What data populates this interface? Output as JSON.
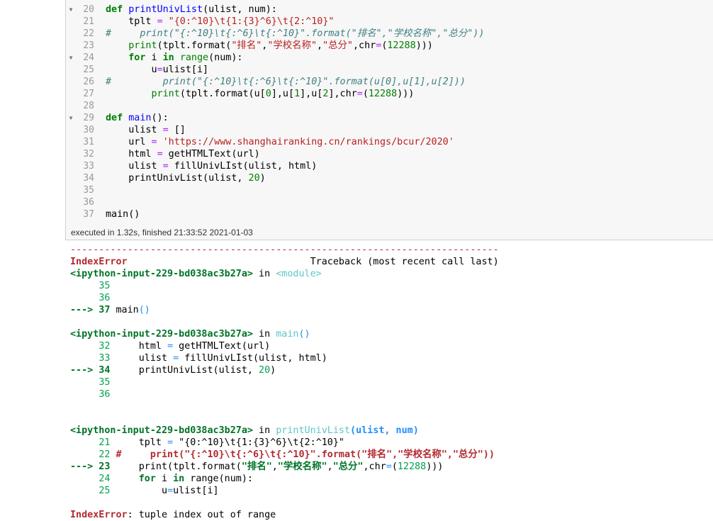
{
  "editor": {
    "lines": [
      {
        "no": "20",
        "fold": true,
        "parts": [
          {
            "t": "def ",
            "c": "kw"
          },
          {
            "t": "printUnivList",
            "c": "fn"
          },
          {
            "t": "(ulist, num):"
          }
        ]
      },
      {
        "no": "21",
        "parts": [
          {
            "t": "    tplt "
          },
          {
            "t": "=",
            "c": "op"
          },
          {
            "t": " \"{0:^10}\\t{1:{3}^6}\\t{2:^10}\"",
            "c": "st"
          }
        ]
      },
      {
        "no": "22",
        "parts": [
          {
            "t": "#     print(\"{:^10}\\t{:^6}\\t{:^10}\".format(\"排名\",\"学校名称\",\"总分\"))",
            "c": "cm"
          }
        ]
      },
      {
        "no": "23",
        "parts": [
          {
            "t": "    "
          },
          {
            "t": "print",
            "c": "bi"
          },
          {
            "t": "(tplt.format("
          },
          {
            "t": "\"排名\"",
            "c": "st"
          },
          {
            "t": ","
          },
          {
            "t": "\"学校名称\"",
            "c": "st"
          },
          {
            "t": ","
          },
          {
            "t": "\"总分\"",
            "c": "st"
          },
          {
            "t": ",chr"
          },
          {
            "t": "=",
            "c": "op"
          },
          {
            "t": "("
          },
          {
            "t": "12288",
            "c": "num"
          },
          {
            "t": ")))"
          }
        ]
      },
      {
        "no": "24",
        "fold": true,
        "parts": [
          {
            "t": "    "
          },
          {
            "t": "for",
            "c": "kw"
          },
          {
            "t": " i "
          },
          {
            "t": "in",
            "c": "kw"
          },
          {
            "t": " "
          },
          {
            "t": "range",
            "c": "bi"
          },
          {
            "t": "(num):"
          }
        ]
      },
      {
        "no": "25",
        "parts": [
          {
            "t": "        u"
          },
          {
            "t": "=",
            "c": "op"
          },
          {
            "t": "ulist[i]"
          }
        ]
      },
      {
        "no": "26",
        "parts": [
          {
            "t": "#         print(\"{:^10}\\t{:^6}\\t{:^10}\".format(u[0],u[1],u[2]))",
            "c": "cm"
          }
        ]
      },
      {
        "no": "27",
        "parts": [
          {
            "t": "        "
          },
          {
            "t": "print",
            "c": "bi"
          },
          {
            "t": "(tplt.format(u["
          },
          {
            "t": "0",
            "c": "num"
          },
          {
            "t": "],u["
          },
          {
            "t": "1",
            "c": "num"
          },
          {
            "t": "],u["
          },
          {
            "t": "2",
            "c": "num"
          },
          {
            "t": "],chr"
          },
          {
            "t": "=",
            "c": "op"
          },
          {
            "t": "("
          },
          {
            "t": "12288",
            "c": "num"
          },
          {
            "t": ")))"
          }
        ]
      },
      {
        "no": "28",
        "parts": []
      },
      {
        "no": "29",
        "fold": true,
        "parts": [
          {
            "t": "def ",
            "c": "kw"
          },
          {
            "t": "main",
            "c": "fn"
          },
          {
            "t": "():"
          }
        ]
      },
      {
        "no": "30",
        "parts": [
          {
            "t": "    ulist "
          },
          {
            "t": "=",
            "c": "op"
          },
          {
            "t": " []"
          }
        ]
      },
      {
        "no": "31",
        "parts": [
          {
            "t": "    url "
          },
          {
            "t": "=",
            "c": "op"
          },
          {
            "t": " "
          },
          {
            "t": "'https://www.shanghairanking.cn/rankings/bcur/2020'",
            "c": "st"
          }
        ]
      },
      {
        "no": "32",
        "parts": [
          {
            "t": "    html "
          },
          {
            "t": "=",
            "c": "op"
          },
          {
            "t": " getHTMLText(url)"
          }
        ]
      },
      {
        "no": "33",
        "parts": [
          {
            "t": "    ulist "
          },
          {
            "t": "=",
            "c": "op"
          },
          {
            "t": " fillUnivLIst(ulist, html)"
          }
        ]
      },
      {
        "no": "34",
        "parts": [
          {
            "t": "    printUnivList(ulist, "
          },
          {
            "t": "20",
            "c": "num"
          },
          {
            "t": ")"
          }
        ]
      },
      {
        "no": "35",
        "parts": []
      },
      {
        "no": "36",
        "parts": []
      },
      {
        "no": "37",
        "parts": [
          {
            "t": "main()"
          }
        ]
      }
    ]
  },
  "exec_status": "executed in 1.32s, finished 21:33:52 2021-01-03",
  "output": {
    "lines": [
      {
        "parts": [
          {
            "t": "---------------------------------------------------------------------------",
            "c": "dash"
          }
        ]
      },
      {
        "parts": [
          {
            "t": "IndexError",
            "c": "red bold"
          },
          {
            "t": "                                Traceback (most recent call last)"
          }
        ]
      },
      {
        "parts": [
          {
            "t": "<ipython-input-229-bd038ac3b27a>",
            "c": "green bold"
          },
          {
            "t": " in "
          },
          {
            "t": "<module>",
            "c": "cyan"
          }
        ]
      },
      {
        "parts": [
          {
            "t": "     "
          },
          {
            "t": "35",
            "c": "grn"
          }
        ]
      },
      {
        "parts": [
          {
            "t": "     "
          },
          {
            "t": "36",
            "c": "grn"
          }
        ]
      },
      {
        "parts": [
          {
            "t": "---> 37",
            "c": "green bold"
          },
          {
            "t": " main"
          },
          {
            "t": "()",
            "c": "blue"
          }
        ]
      },
      {
        "parts": []
      },
      {
        "parts": [
          {
            "t": "<ipython-input-229-bd038ac3b27a>",
            "c": "green bold"
          },
          {
            "t": " in "
          },
          {
            "t": "main",
            "c": "cyan"
          },
          {
            "t": "()",
            "c": "blue"
          }
        ]
      },
      {
        "parts": [
          {
            "t": "     "
          },
          {
            "t": "32",
            "c": "grn"
          },
          {
            "t": "     html "
          },
          {
            "t": "=",
            "c": "blue"
          },
          {
            "t": " getHTMLText(url)"
          }
        ]
      },
      {
        "parts": [
          {
            "t": "     "
          },
          {
            "t": "33",
            "c": "grn"
          },
          {
            "t": "     ulist "
          },
          {
            "t": "=",
            "c": "blue"
          },
          {
            "t": " fillUnivLIst(ulist, html)"
          }
        ]
      },
      {
        "parts": [
          {
            "t": "---> 34",
            "c": "green bold"
          },
          {
            "t": "     printUnivList(ulist, "
          },
          {
            "t": "20",
            "c": "grn"
          },
          {
            "t": ")"
          }
        ]
      },
      {
        "parts": [
          {
            "t": "     "
          },
          {
            "t": "35",
            "c": "grn"
          }
        ]
      },
      {
        "parts": [
          {
            "t": "     "
          },
          {
            "t": "36",
            "c": "grn"
          }
        ]
      },
      {
        "parts": []
      },
      {
        "parts": []
      },
      {
        "parts": [
          {
            "t": "<ipython-input-229-bd038ac3b27a>",
            "c": "green bold"
          },
          {
            "t": " in "
          },
          {
            "t": "printUnivList",
            "c": "cyan"
          },
          {
            "t": "(ulist, num)",
            "c": "blue bold"
          }
        ]
      },
      {
        "parts": [
          {
            "t": "     "
          },
          {
            "t": "21",
            "c": "grn"
          },
          {
            "t": "     tplt "
          },
          {
            "t": "=",
            "c": "blue"
          },
          {
            "t": " \"{0:^10}\\t{1:{3}^6}\\t{2:^10}\""
          }
        ]
      },
      {
        "parts": [
          {
            "t": "     "
          },
          {
            "t": "22",
            "c": "grn"
          },
          {
            "t": " #     print(\"{:^10}\\t{:^6}\\t{:^10}\".format(\"排名\",\"学校名称\",\"总分\"))",
            "c": "red bold"
          }
        ]
      },
      {
        "parts": [
          {
            "t": "---> 23",
            "c": "green bold"
          },
          {
            "t": "     print(tplt.format("
          },
          {
            "t": "\"排名\"",
            "c": "green bold"
          },
          {
            "t": ","
          },
          {
            "t": "\"学校名称\"",
            "c": "green bold"
          },
          {
            "t": ","
          },
          {
            "t": "\"总分\"",
            "c": "green bold"
          },
          {
            "t": ",chr"
          },
          {
            "t": "=",
            "c": "blue"
          },
          {
            "t": "("
          },
          {
            "t": "12288",
            "c": "grn"
          },
          {
            "t": ")))"
          }
        ]
      },
      {
        "parts": [
          {
            "t": "     "
          },
          {
            "t": "24",
            "c": "grn"
          },
          {
            "t": "     "
          },
          {
            "t": "for",
            "c": "green bold"
          },
          {
            "t": " i "
          },
          {
            "t": "in",
            "c": "green bold"
          },
          {
            "t": " range(num):"
          }
        ]
      },
      {
        "parts": [
          {
            "t": "     "
          },
          {
            "t": "25",
            "c": "grn"
          },
          {
            "t": "         u"
          },
          {
            "t": "=",
            "c": "blue"
          },
          {
            "t": "ulist[i]"
          }
        ]
      },
      {
        "parts": []
      },
      {
        "parts": [
          {
            "t": "IndexError",
            "c": "red bold"
          },
          {
            "t": ": tuple index out of range"
          }
        ]
      }
    ]
  }
}
